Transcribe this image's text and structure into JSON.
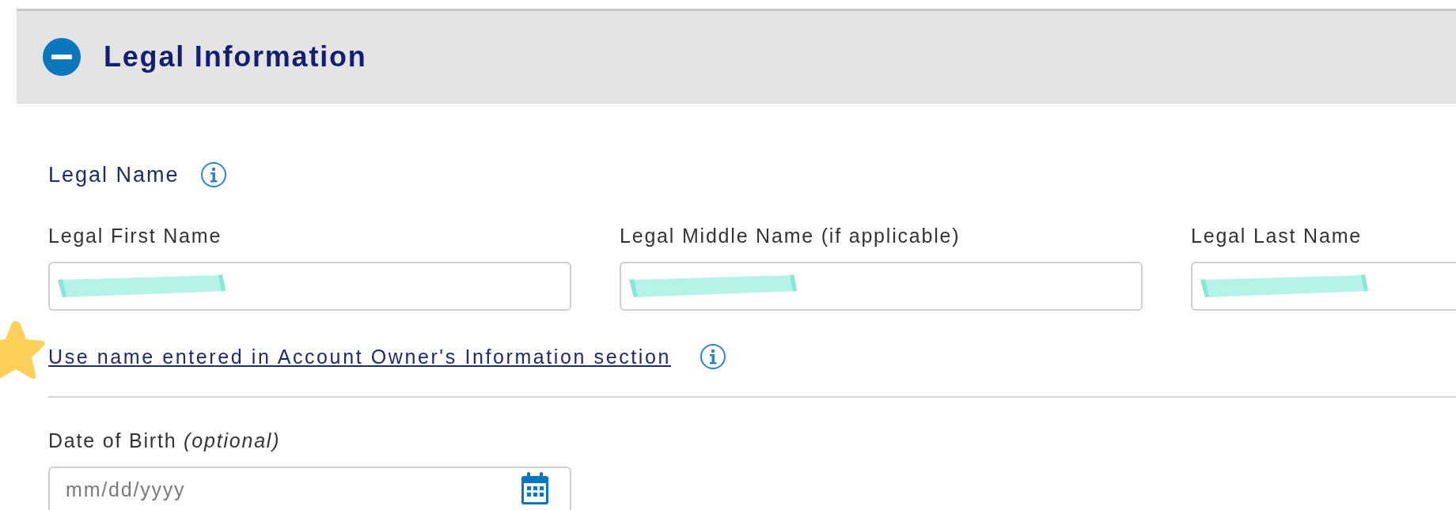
{
  "section": {
    "title": "Legal Information",
    "expanded": true
  },
  "legal_name": {
    "heading": "Legal Name"
  },
  "fields": [
    {
      "label": "Legal First Name",
      "redacted": true
    },
    {
      "label": "Legal Middle Name (if applicable)",
      "redacted": true
    },
    {
      "label": "Legal Last Name",
      "redacted": true
    }
  ],
  "link": "Use name entered in Account Owner's Information section",
  "date_of_birth": {
    "label": "Date of Birth *(optional)*",
    "placeholder": "mm/dd/yyyy"
  }
}
